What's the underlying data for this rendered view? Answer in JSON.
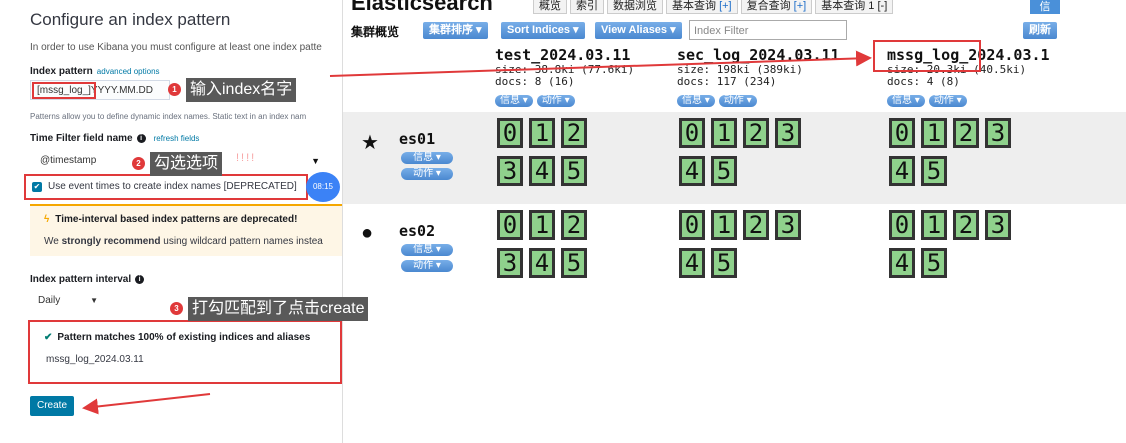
{
  "kibana": {
    "title": "Configure an index pattern",
    "intro": "In order to use Kibana you must configure at least one index patte",
    "index_pattern_label": "Index pattern",
    "advanced_options_link": "advanced options",
    "index_pattern_value_prefix": "[mssg_log_]",
    "index_pattern_value_suffix": "YYYY.MM.DD",
    "patterns_help": "Patterns allow you to define dynamic index names. Static text in an index nam",
    "time_field_label": "Time Filter field name",
    "refresh_fields_link": "refresh fields",
    "time_field_value": "@timestamp",
    "checkbox_label": "Use event times to create index names [DEPRECATED]",
    "time_badge": "08:15",
    "callout_title": "Time-interval based index patterns are deprecated!",
    "callout_body_before": "We ",
    "callout_body_bold": "strongly recommend",
    "callout_body_after": " using wildcard pattern names instea",
    "interval_label": "Index pattern interval",
    "interval_value": "Daily",
    "match_title": "Pattern matches 100% of existing indices and aliases",
    "match_item": "mssg_log_2024.03.11",
    "create_button": "Create"
  },
  "annotations": {
    "step1": {
      "num": "1",
      "text": "输入index名字"
    },
    "step2": {
      "num": "2",
      "text": "勾选选项"
    },
    "step2_marks": "!!!!",
    "step3": {
      "num": "3",
      "text": "打勾匹配到了点击create"
    }
  },
  "eshead": {
    "brand": "Elasticsearch",
    "tabs": [
      "概览",
      "索引",
      "数据浏览"
    ],
    "tab_basic_query": "基本查询",
    "tab_basic_query_plus": "[+]",
    "tab_compound_query": "复合查询",
    "tab_compound_query_plus": "[+]",
    "tab_basic_query_1": "基本查询 1",
    "tab_basic_query_1_minus": "[-]",
    "top_info_button": "信",
    "overview_label": "集群概览",
    "sort_cluster_button": "集群排序 ▾",
    "sort_indices_button": "Sort Indices ▾",
    "view_aliases_button": "View Aliases ▾",
    "index_filter_placeholder": "Index Filter",
    "refresh_button": "刷新",
    "info_button": "信息 ▾",
    "action_button": "动作 ▾",
    "indices": [
      {
        "name": "test_2024.03.11",
        "size": "size: 38.8ki (77.6ki)",
        "docs": "docs: 8 (16)"
      },
      {
        "name": "sec_log_2024.03.11",
        "size": "size: 198ki (389ki)",
        "docs": "docs: 117 (234)"
      },
      {
        "name": "mssg_log_2024.03.1",
        "size": "size: 20.3ki (40.5ki)",
        "docs": "docs: 4 (8)"
      }
    ],
    "nodes": [
      {
        "name": "es01",
        "symbol": "★",
        "shards": [
          [
            "0",
            "1",
            "2",
            "3",
            "4",
            "5"
          ],
          [
            "0",
            "1",
            "2",
            "3",
            "4",
            "5"
          ],
          [
            "0",
            "1",
            "2",
            "3",
            "4",
            "5"
          ]
        ]
      },
      {
        "name": "es02",
        "symbol": "●",
        "shards": [
          [
            "0",
            "1",
            "2",
            "3",
            "4",
            "5"
          ],
          [
            "0",
            "1",
            "2",
            "3",
            "4",
            "5"
          ],
          [
            "0",
            "1",
            "2",
            "3",
            "4",
            "5"
          ]
        ]
      }
    ]
  }
}
